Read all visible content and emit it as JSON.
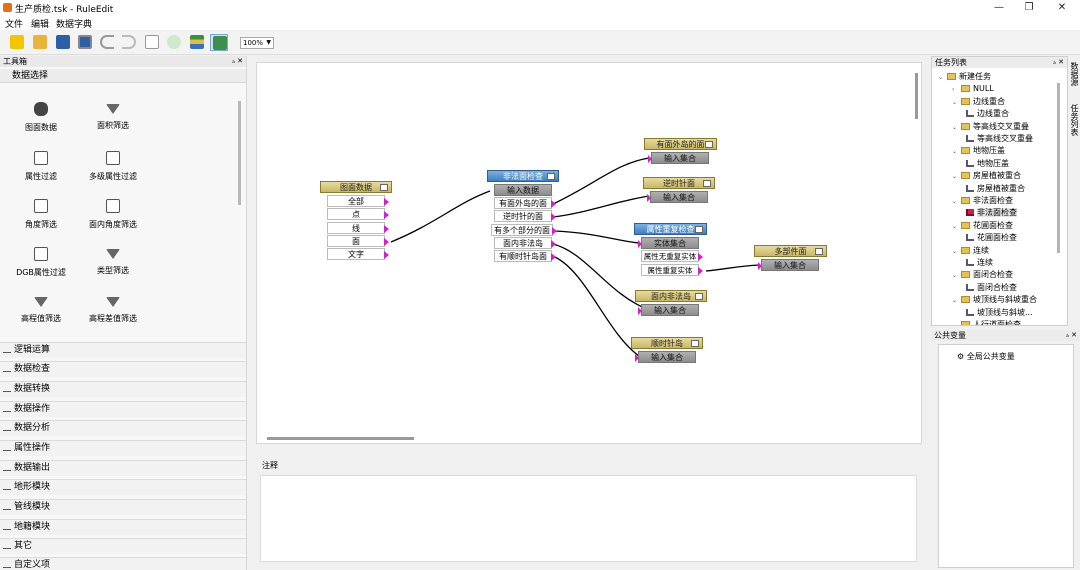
{
  "window": {
    "title": "生产质检.tsk - RuleEdit",
    "minimize": "—",
    "maximize": "❐",
    "close": "✕"
  },
  "menu": [
    "文件",
    "编辑",
    "数据字典"
  ],
  "toolbar": {
    "zoom": "100%"
  },
  "toolbox": {
    "title": "工具箱",
    "section": "数据选择",
    "tools": [
      "图面数据",
      "面积筛选",
      "属性过滤",
      "多级属性过滤",
      "角度筛选",
      "面内角度筛选",
      "DGB属性过滤",
      "类型筛选",
      "高程值筛选",
      "高程差值筛选"
    ],
    "categories": [
      "逻辑运算",
      "数据检查",
      "数据转换",
      "数据操作",
      "数据分析",
      "属性操作",
      "数据输出",
      "地形模块",
      "管线模块",
      "地籍模块",
      "其它",
      "自定义项"
    ]
  },
  "nodes": {
    "tumian": {
      "title": "图面数据",
      "ports": [
        "全部",
        "点",
        "线",
        "面",
        "文字"
      ]
    },
    "feifa": {
      "title": "非法面检查",
      "input": "输入数据",
      "outputs": [
        "有面外岛的面",
        "逆时针的面",
        "有多个部分的面",
        "面内非法岛",
        "有顺时针岛面"
      ]
    },
    "youmian": {
      "title": "有面外岛的面",
      "input": "输入集合"
    },
    "nishizhen": {
      "title": "逆时针面",
      "input": "输入集合"
    },
    "shuxing": {
      "title": "属性重复检查",
      "input": "实体集合",
      "outputs": [
        "属性无重复实体",
        "属性重复实体"
      ]
    },
    "duobujian": {
      "title": "多部件面",
      "input": "输入集合"
    },
    "miannei": {
      "title": "面内非法岛",
      "input": "输入集合"
    },
    "shunshizhen": {
      "title": "顺时针岛",
      "input": "输入集合"
    }
  },
  "notes": {
    "label": "注释"
  },
  "tasks": {
    "title": "任务列表",
    "items": [
      {
        "label": "新建任务",
        "level": 0,
        "kind": "folder",
        "expanded": true
      },
      {
        "label": "NULL",
        "level": 1,
        "kind": "folder",
        "expanded": false
      },
      {
        "label": "边线重合",
        "level": 1,
        "kind": "folder",
        "expanded": true
      },
      {
        "label": "边线重合",
        "level": 2,
        "kind": "rule"
      },
      {
        "label": "等高线交叉重叠",
        "level": 1,
        "kind": "folder",
        "expanded": true
      },
      {
        "label": "等高线交叉重叠",
        "level": 2,
        "kind": "rule"
      },
      {
        "label": "地物压盖",
        "level": 1,
        "kind": "folder",
        "expanded": true
      },
      {
        "label": "地物压盖",
        "level": 2,
        "kind": "rule"
      },
      {
        "label": "房屋植被重合",
        "level": 1,
        "kind": "folder",
        "expanded": true
      },
      {
        "label": "房屋植被重合",
        "level": 2,
        "kind": "rule"
      },
      {
        "label": "非法面检查",
        "level": 1,
        "kind": "folder",
        "expanded": true
      },
      {
        "label": "非法面检查",
        "level": 2,
        "kind": "rule",
        "selected": true
      },
      {
        "label": "花圃面检查",
        "level": 1,
        "kind": "folder",
        "expanded": true
      },
      {
        "label": "花圃面检查",
        "level": 2,
        "kind": "rule"
      },
      {
        "label": "连续",
        "level": 1,
        "kind": "folder",
        "expanded": true
      },
      {
        "label": "连续",
        "level": 2,
        "kind": "rule"
      },
      {
        "label": "面闭合检查",
        "level": 1,
        "kind": "folder",
        "expanded": true
      },
      {
        "label": "面闭合检查",
        "level": 2,
        "kind": "rule"
      },
      {
        "label": "坡顶线与斜坡重合",
        "level": 1,
        "kind": "folder",
        "expanded": true
      },
      {
        "label": "坡顶线与斜坡...",
        "level": 2,
        "kind": "rule"
      },
      {
        "label": "人行道面检查",
        "level": 1,
        "kind": "folder",
        "expanded": true
      }
    ]
  },
  "side_tabs": [
    "数据源",
    "任务列表"
  ],
  "variables": {
    "title": "公共变量",
    "global": "全局公共变量"
  },
  "colors": {
    "node_head": "#c9b766",
    "node_head_active": "#3f7fbf",
    "pin": "#d020d0",
    "wire": "#000000"
  }
}
